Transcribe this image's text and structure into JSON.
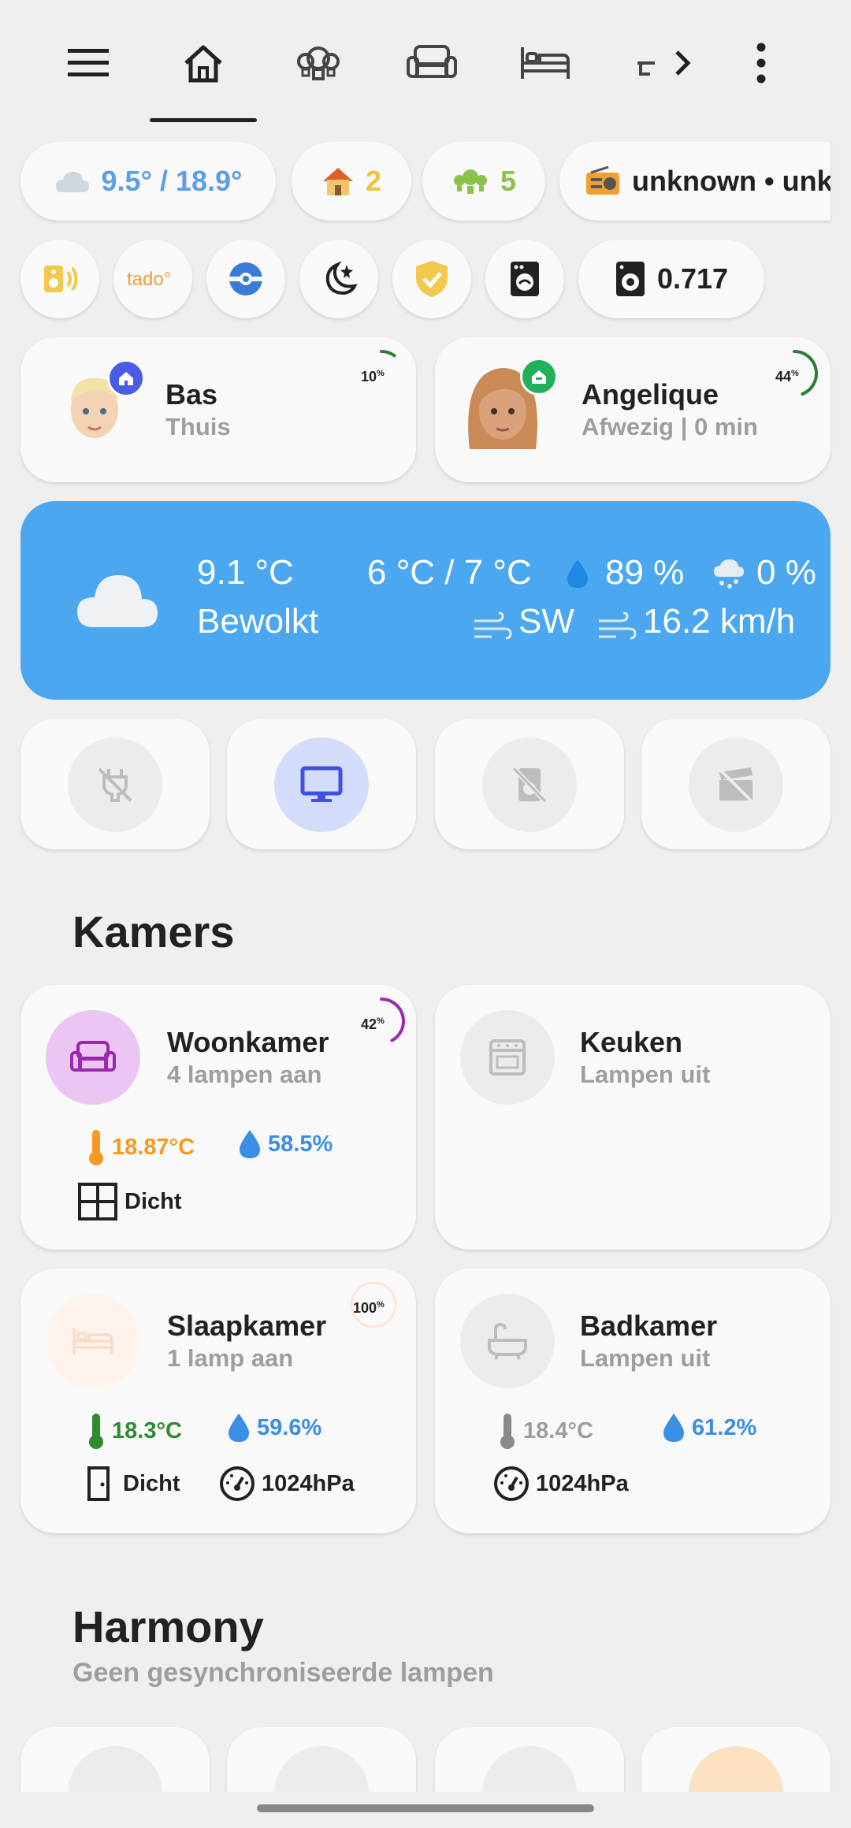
{
  "colors": {
    "background": "#efefef",
    "card": "#f9f9f9",
    "weather_card": "#4aa7f0",
    "weather_chip_text": "#5c9fe8",
    "home_chip_text": "#f0c33c",
    "lights_chip_text": "#8bc34a",
    "woonkamer_accent": "#9c27b0",
    "temp_orange": "#f59a1f",
    "temp_green": "#2e8b2e",
    "humidity_blue": "#3b8ee6",
    "tv_blue": "#3f51e0"
  },
  "nav": {
    "icons": [
      "menu-icon",
      "home-icon",
      "lightbulb-group-icon",
      "sofa-icon",
      "bed-icon",
      "partial-icon",
      "chevron-right-icon",
      "more-vertical-icon"
    ],
    "active_tab": "home"
  },
  "chips": {
    "weather": "9.5° / 18.9°",
    "home_count": "2",
    "lights_count": "5",
    "radio": "unknown • unk",
    "energy": "0.717"
  },
  "persons": {
    "bas": {
      "name": "Bas",
      "status": "Thuis",
      "battery": "10",
      "battery_unit": "%",
      "battery_level": 0.1
    },
    "angelique": {
      "name": "Angelique",
      "status": "Afwezig | 0 min",
      "battery": "44",
      "battery_unit": "%",
      "battery_level": 0.44
    }
  },
  "weather": {
    "temperature": "9.1 °C",
    "condition": "Bewolkt",
    "min_max": "6 °C / 7 °C",
    "humidity": "89 %",
    "precipitation": "0 %",
    "wind_direction": "SW",
    "wind_speed": "16.2 km/h"
  },
  "sections": {
    "kamers": "Kamers",
    "harmony": "Harmony",
    "harmony_sub": "Geen gesynchroniseerde lampen"
  },
  "rooms": {
    "woonkamer": {
      "name": "Woonkamer",
      "status": "4 lampen aan",
      "light_pct": "42",
      "light_level": 0.42,
      "temperature": "18.87°C",
      "humidity": "58.5%",
      "window": "Dicht"
    },
    "keuken": {
      "name": "Keuken",
      "status": "Lampen uit"
    },
    "slaapkamer": {
      "name": "Slaapkamer",
      "status": "1 lamp aan",
      "light_pct": "100",
      "light_level": 1.0,
      "temperature": "18.3°C",
      "humidity": "59.6%",
      "door": "Dicht",
      "pressure": "1024hPa"
    },
    "badkamer": {
      "name": "Badkamer",
      "status": "Lampen uit",
      "temperature": "18.4°C",
      "humidity": "61.2%",
      "pressure": "1024hPa"
    }
  }
}
